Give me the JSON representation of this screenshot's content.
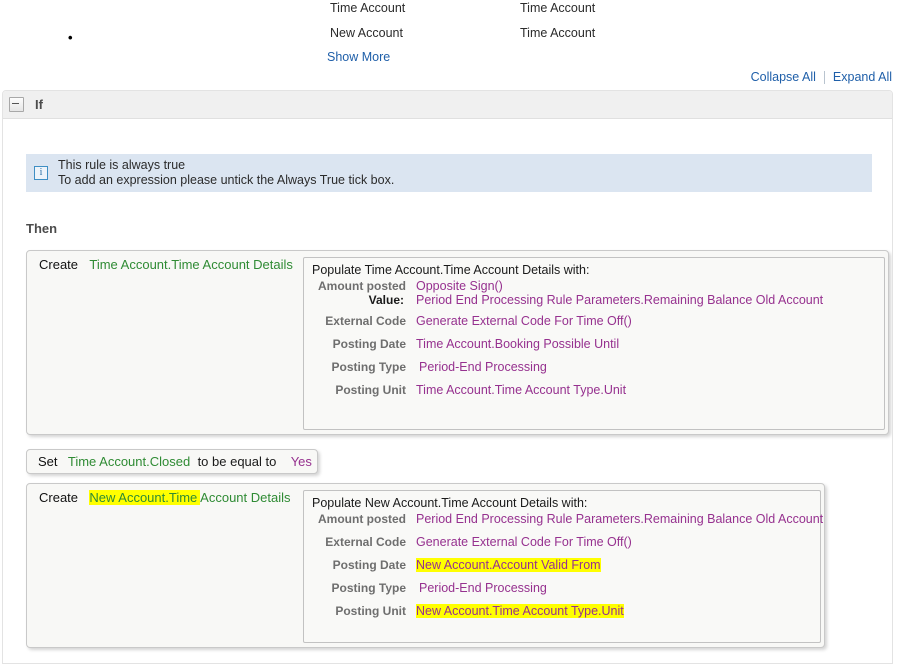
{
  "top": {
    "marker": "•",
    "columns": [
      {
        "left": "Time Account",
        "right": "Time Account"
      },
      {
        "left": "New Account",
        "right": "Time Account"
      }
    ],
    "show_more": "Show More"
  },
  "toolbar": {
    "collapse_all": "Collapse All",
    "expand_all": "Expand All"
  },
  "section": {
    "title": "If",
    "collapse_icon": "minus-icon"
  },
  "banner": {
    "icon": "info-icon",
    "line1": "This rule is always true",
    "line2": "To add an expression please untick the Always True tick box."
  },
  "then": {
    "label": "Then"
  },
  "actions": [
    {
      "keyword": "Create",
      "target": "Time Account.Time Account Details",
      "target_highlight": "",
      "panel_title": "Populate Time Account.Time Account Details with:",
      "fields": [
        {
          "label": "Amount posted",
          "value": "Opposite Sign()",
          "highlight": false,
          "sub_label": "Value:",
          "sub_value": "Period End Processing Rule Parameters.Remaining Balance Old Account"
        },
        {
          "label": "External Code",
          "value": "Generate External Code For Time Off()",
          "highlight": false
        },
        {
          "label": "Posting Date",
          "value": "Time Account.Booking Possible Until",
          "highlight": false
        },
        {
          "label": "Posting Type",
          "value": "Period-End Processing",
          "highlight": false,
          "indent": true
        },
        {
          "label": "Posting Unit",
          "value": "Time Account.Time Account Type.Unit",
          "highlight": false
        }
      ]
    },
    {
      "keyword": "Create",
      "target_highlight": "New Account.Time ",
      "target_rest": "Account Details",
      "panel_title": "Populate New Account.Time Account Details with:",
      "fields": [
        {
          "label": "Amount posted",
          "value": "Period End Processing Rule Parameters.Remaining Balance Old Account",
          "highlight": false
        },
        {
          "label": "External Code",
          "value": "Generate External Code For Time Off()",
          "highlight": false
        },
        {
          "label": "Posting Date",
          "value": "New Account.Account Valid From",
          "highlight": true
        },
        {
          "label": "Posting Type",
          "value": "Period-End Processing",
          "highlight": false,
          "indent": true
        },
        {
          "label": "Posting Unit",
          "value": "New Account.Time Account Type.Unit",
          "highlight": true
        }
      ]
    }
  ],
  "set_action": {
    "keyword": "Set",
    "reference": "Time Account.Closed",
    "operator": "to be equal to",
    "value": "Yes"
  },
  "colors": {
    "reference_green": "#2f8b34",
    "value_purple": "#96318f",
    "link_blue": "#1f5fa9",
    "highlight_yellow": "#ffff00",
    "banner_blue": "#dbe5f1",
    "header_gray": "#f0f0f0"
  }
}
